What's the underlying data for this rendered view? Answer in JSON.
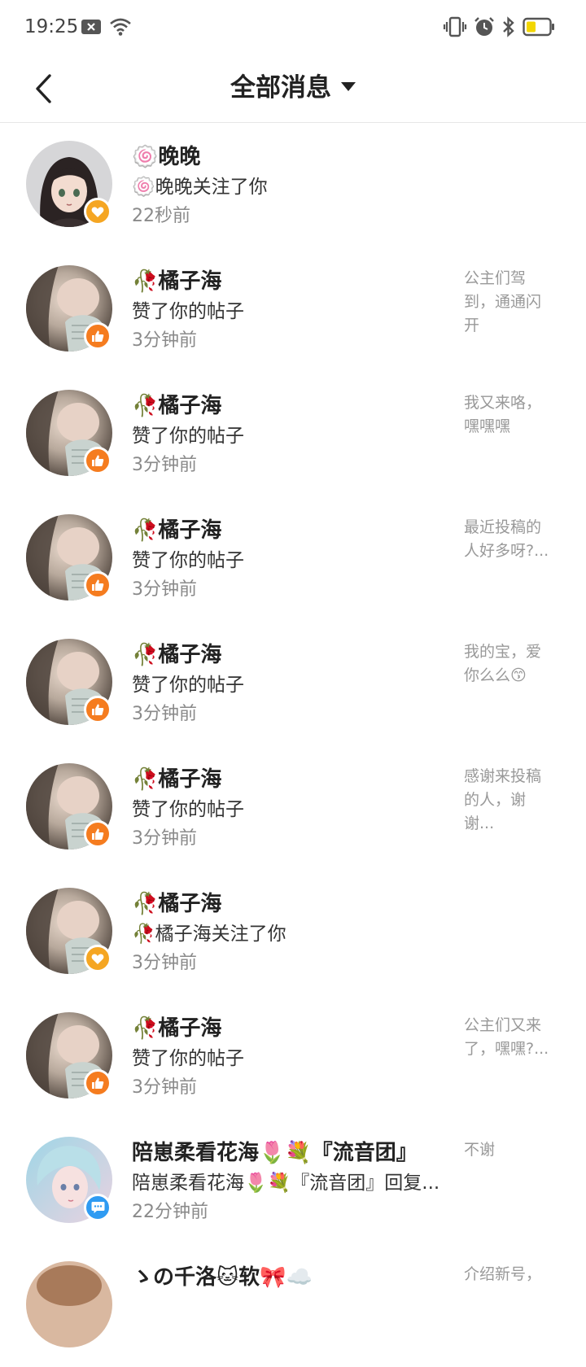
{
  "status_bar": {
    "time": "19:25",
    "icons": [
      "notification-x-icon",
      "wifi-icon",
      "vibrate-icon",
      "alarm-icon",
      "bluetooth-icon",
      "battery-icon"
    ],
    "battery_color": "#f2d600"
  },
  "header": {
    "title": "全部消息",
    "back_icon": "chevron-left-icon",
    "dropdown_icon": "caret-down-icon"
  },
  "colors": {
    "like_badge": "#f57c1f",
    "follow_badge": "#f5a623",
    "reply_badge": "#2f9bf2"
  },
  "messages": [
    {
      "name": "🍥晚晚",
      "action": "🍥晚晚关注了你",
      "time": "22秒前",
      "preview": "",
      "badge": "follow"
    },
    {
      "name": "🥀橘子海",
      "action": "赞了你的帖子",
      "time": "3分钟前",
      "preview": "公主们驾到，通通闪开",
      "badge": "like"
    },
    {
      "name": "🥀橘子海",
      "action": "赞了你的帖子",
      "time": "3分钟前",
      "preview": "我又来咯，嘿嘿嘿",
      "badge": "like"
    },
    {
      "name": "🥀橘子海",
      "action": "赞了你的帖子",
      "time": "3分钟前",
      "preview": "最近投稿的人好多呀?...",
      "badge": "like"
    },
    {
      "name": "🥀橘子海",
      "action": "赞了你的帖子",
      "time": "3分钟前",
      "preview": "我的宝，爱你么么😙",
      "badge": "like"
    },
    {
      "name": "🥀橘子海",
      "action": "赞了你的帖子",
      "time": "3分钟前",
      "preview": "感谢来投稿的人，谢谢...",
      "badge": "like"
    },
    {
      "name": "🥀橘子海",
      "action": "🥀橘子海关注了你",
      "time": "3分钟前",
      "preview": "",
      "badge": "follow"
    },
    {
      "name": "🥀橘子海",
      "action": "赞了你的帖子",
      "time": "3分钟前",
      "preview": "公主们又来了，嘿嘿?...",
      "badge": "like"
    },
    {
      "name": "陪崽柔看花海🌷💐『流音团』",
      "action": "陪崽柔看花海🌷💐『流音团』回复...",
      "time": "22分钟前",
      "preview": "不谢",
      "badge": "reply"
    },
    {
      "name": "ゝの千洛🐱软🎀☁️",
      "action": "",
      "time": "",
      "preview": "介绍新号，",
      "badge": ""
    }
  ]
}
